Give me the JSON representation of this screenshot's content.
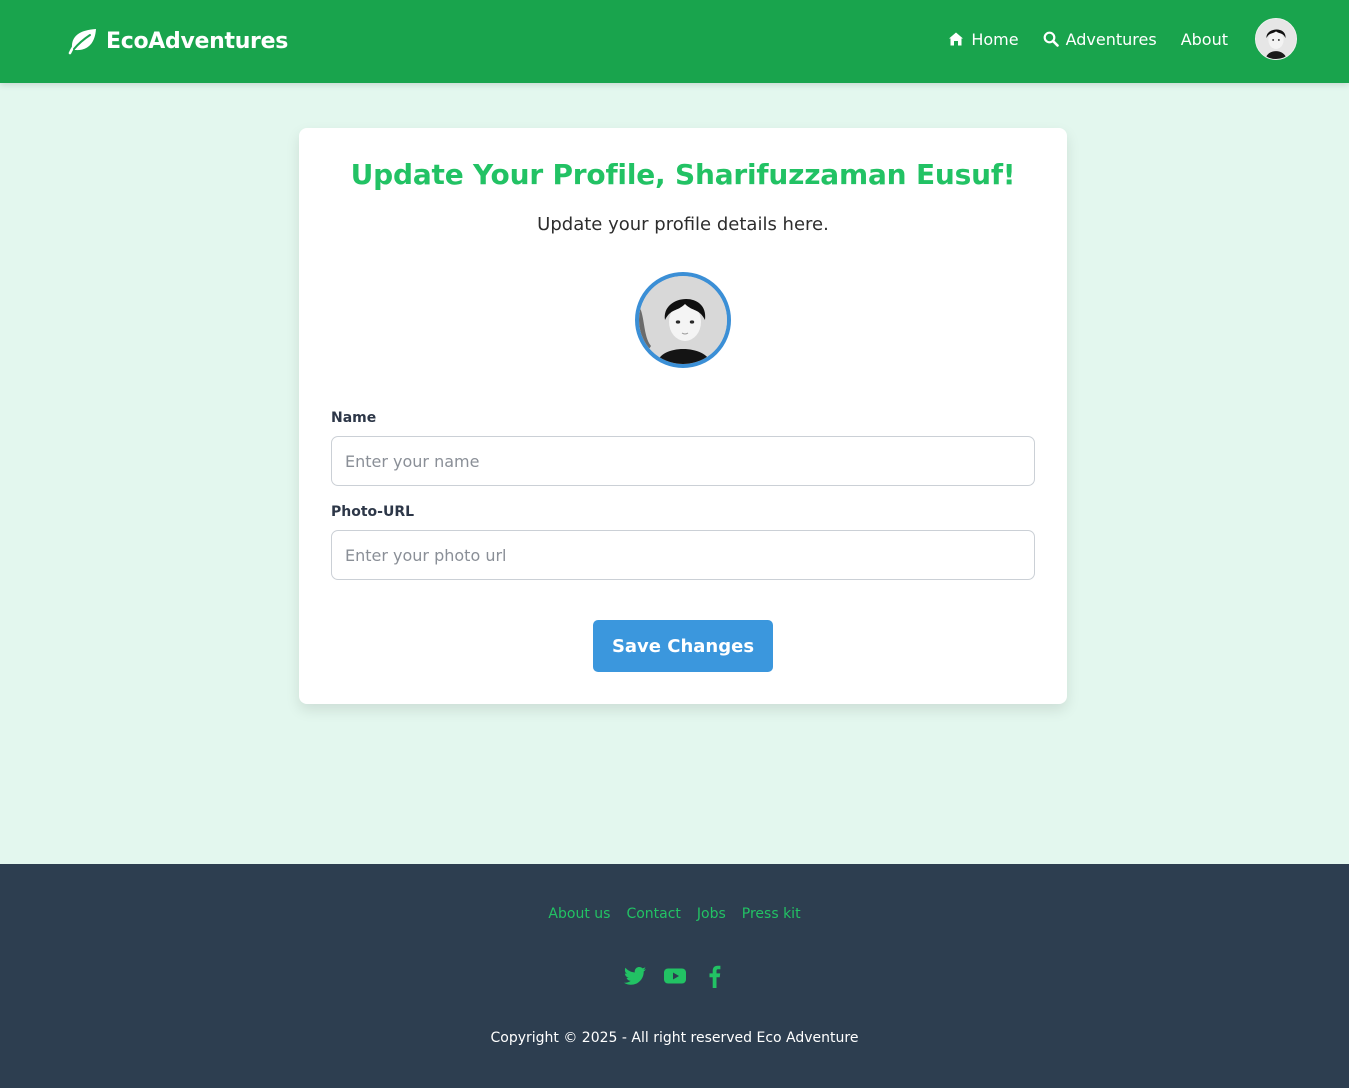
{
  "colors": {
    "navbar": "#19a44d",
    "page_background": "#e3f7ee",
    "accent_green": "#22c264",
    "button_blue": "#3b97dd",
    "footer": "#2d3e50"
  },
  "navbar": {
    "brand": "EcoAdventures",
    "brand_icon": "leaf-icon",
    "links": [
      {
        "label": "Home",
        "icon": "home-icon"
      },
      {
        "label": "Adventures",
        "icon": "search-icon"
      },
      {
        "label": "About",
        "icon": ""
      }
    ],
    "avatar": "user-avatar"
  },
  "profile_card": {
    "title": "Update Your Profile, Sharifuzzaman Eusuf!",
    "subtitle": "Update your profile details here.",
    "fields": [
      {
        "label": "Name",
        "value": "",
        "placeholder": "Enter your name"
      },
      {
        "label": "Photo-URL",
        "value": "",
        "placeholder": "Enter your photo url"
      }
    ],
    "save_label": "Save Changes"
  },
  "footer": {
    "links": [
      "About us",
      "Contact",
      "Jobs",
      "Press kit"
    ],
    "social": [
      "twitter-icon",
      "youtube-icon",
      "facebook-icon"
    ],
    "copyright": "Copyright © 2025 - All right reserved Eco Adventure"
  }
}
